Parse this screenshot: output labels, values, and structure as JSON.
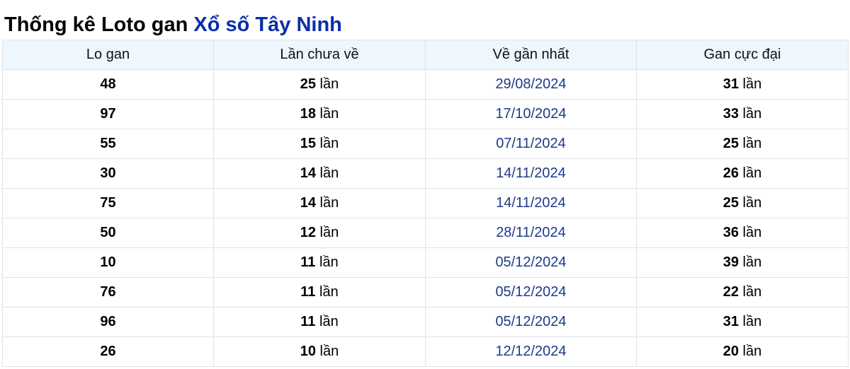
{
  "title": {
    "prefix": "Thống kê Loto gan ",
    "link": "Xổ số Tây Ninh"
  },
  "table": {
    "headers": [
      "Lo gan",
      "Lần chưa về",
      "Về gần nhất",
      "Gan cực đại"
    ],
    "unit": "lần",
    "rows": [
      {
        "number": "48",
        "missing": "25",
        "last": "29/08/2024",
        "max": "31"
      },
      {
        "number": "97",
        "missing": "18",
        "last": "17/10/2024",
        "max": "33"
      },
      {
        "number": "55",
        "missing": "15",
        "last": "07/11/2024",
        "max": "25"
      },
      {
        "number": "30",
        "missing": "14",
        "last": "14/11/2024",
        "max": "26"
      },
      {
        "number": "75",
        "missing": "14",
        "last": "14/11/2024",
        "max": "25"
      },
      {
        "number": "50",
        "missing": "12",
        "last": "28/11/2024",
        "max": "36"
      },
      {
        "number": "10",
        "missing": "11",
        "last": "05/12/2024",
        "max": "39"
      },
      {
        "number": "76",
        "missing": "11",
        "last": "05/12/2024",
        "max": "22"
      },
      {
        "number": "96",
        "missing": "11",
        "last": "05/12/2024",
        "max": "31"
      },
      {
        "number": "26",
        "missing": "10",
        "last": "12/12/2024",
        "max": "20"
      }
    ]
  }
}
